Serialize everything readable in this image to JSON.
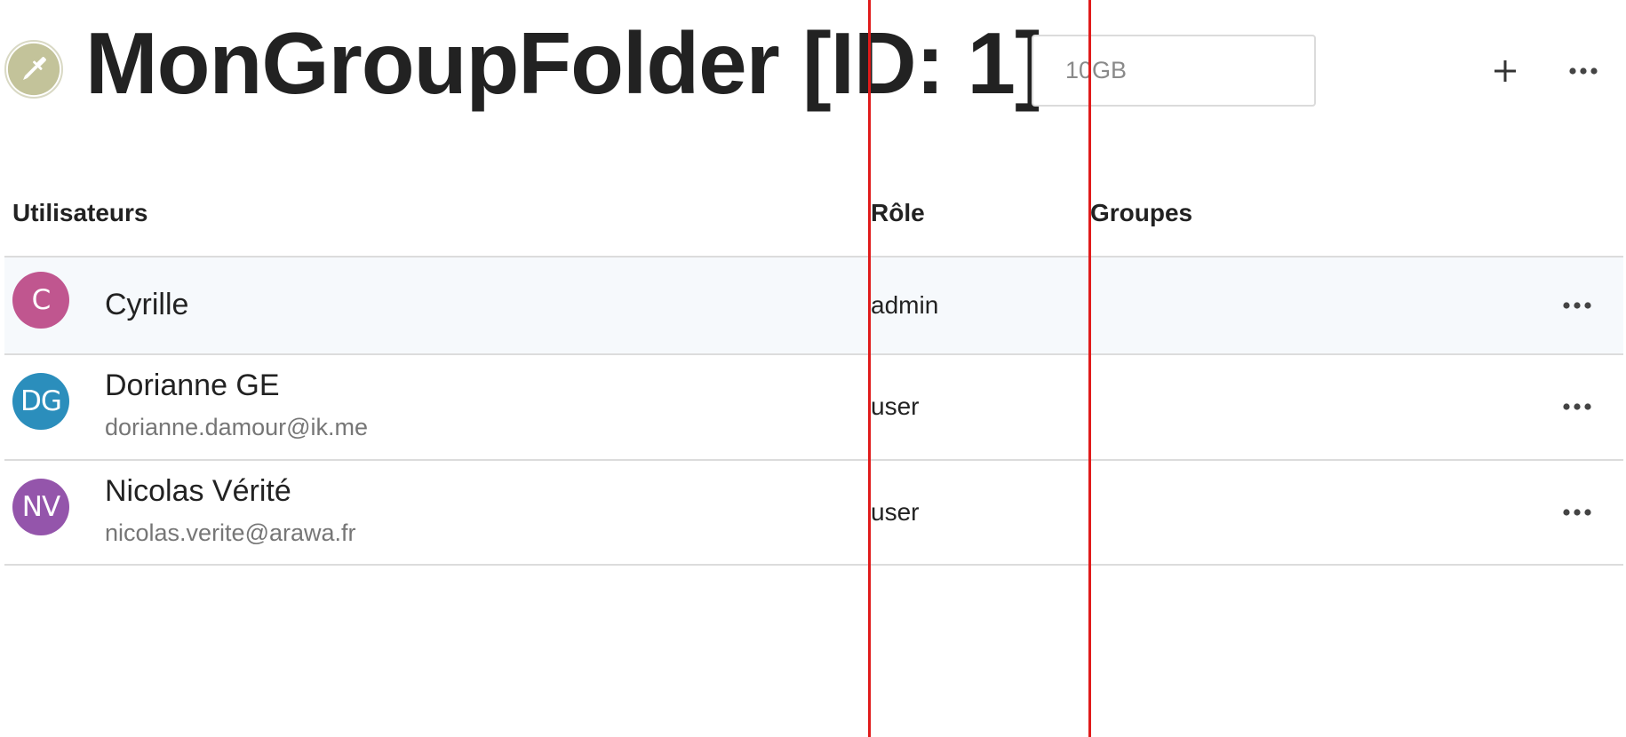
{
  "header": {
    "title": "MonGroupFolder [ID: 1]",
    "quota": {
      "value": "",
      "placeholder": "10GB"
    },
    "color_picker_color": "#c3c39a",
    "icons": {
      "color_picker": "eyedropper-icon",
      "add": "plus-icon",
      "more": "more-horizontal-icon"
    }
  },
  "table": {
    "columns": {
      "users": "Utilisateurs",
      "role": "Rôle",
      "groups": "Groupes"
    },
    "rows": [
      {
        "initials": "C",
        "name": "Cyrille",
        "email": "",
        "role": "admin",
        "avatar_color": "#c0568f"
      },
      {
        "initials": "DG",
        "name": "Dorianne GE",
        "email": "dorianne.damour@ik.me",
        "role": "user",
        "avatar_color": "#2b8ebc"
      },
      {
        "initials": "NV",
        "name": "Nicolas Vérité",
        "email": "nicolas.verite@arawa.fr",
        "role": "user",
        "avatar_color": "#9455ab"
      }
    ]
  },
  "colors": {
    "guide": "#e01b1b",
    "selected_row": "#f6f9fc",
    "border": "#dcdcdc"
  }
}
